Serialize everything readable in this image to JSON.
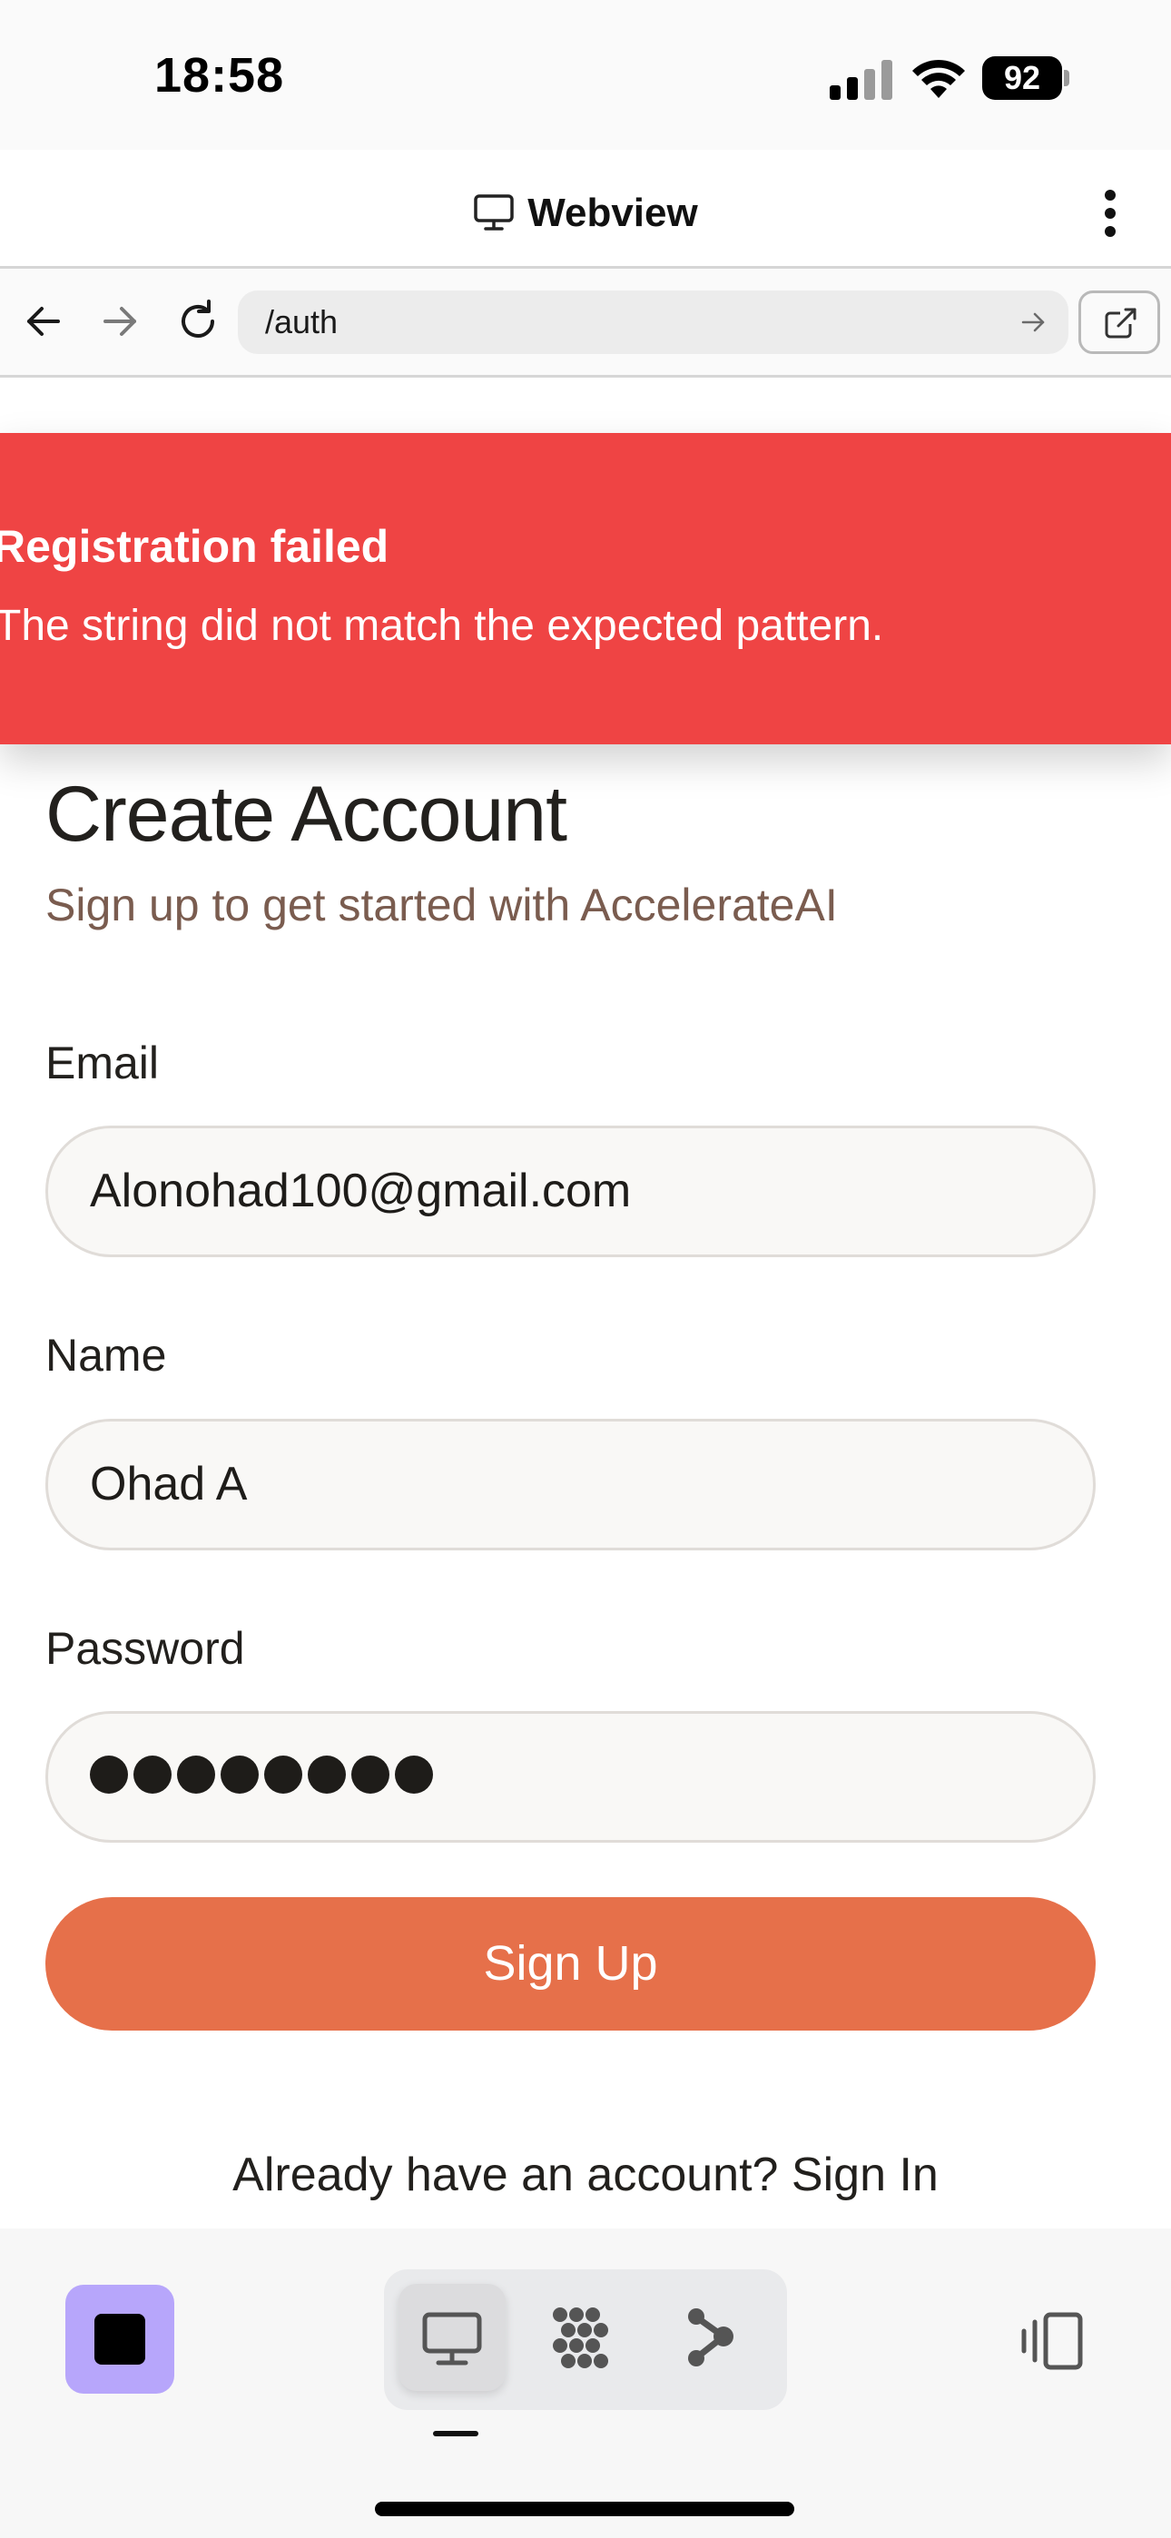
{
  "status_bar": {
    "time": "18:58",
    "battery": "92"
  },
  "webview": {
    "title": "Webview"
  },
  "toolbar": {
    "url": "/auth"
  },
  "toast": {
    "title": "Registration failed",
    "message": "The string did not match the expected pattern.",
    "color": "#ef4444"
  },
  "form": {
    "title": "Create Account",
    "subtitle": "Sign up to get started with AccelerateAI",
    "email": {
      "label": "Email",
      "value": "Alonohad100@gmail.com"
    },
    "name": {
      "label": "Name",
      "value": "Ohad A"
    },
    "password": {
      "label": "Password",
      "masked_length": 8
    },
    "submit_label": "Sign Up",
    "signin_prompt": "Already have an account? Sign In",
    "accent_color": "#e6704a"
  },
  "bottom_bar": {
    "stop_color": "#b7a6fb",
    "tabs": [
      {
        "icon": "monitor-icon",
        "active": true
      },
      {
        "icon": "dots-grid-icon",
        "active": false
      },
      {
        "icon": "branch-icon",
        "active": false
      }
    ],
    "panel_icon": "panel-icon"
  }
}
